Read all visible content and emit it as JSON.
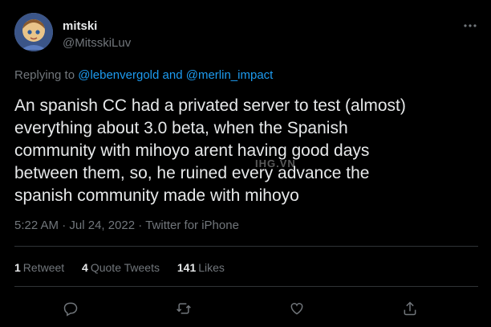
{
  "user": {
    "name": "mitski",
    "handle": "@MitsskiLuv"
  },
  "reply": {
    "prefix": "Replying to",
    "mention1": "@lebenvergold",
    "conj": "and",
    "mention2": "@merlin_impact"
  },
  "tweet": {
    "line1": "An spanish CC had a privated server to test (almost)",
    "line2": "everything about 3.0 beta, when the Spanish",
    "line3": "community with mihoyo arent having good days",
    "line4": "between them, so, he ruined every advance the",
    "line5": "spanish community made with mihoyo"
  },
  "meta": {
    "time": "5:22 AM",
    "dot": "·",
    "date": "Jul 24, 2022",
    "source": "Twitter for iPhone"
  },
  "stats": {
    "retweets_count": "1",
    "retweets_label": "Retweet",
    "quotes_count": "4",
    "quotes_label": "Quote Tweets",
    "likes_count": "141",
    "likes_label": "Likes"
  },
  "watermark": "IHG.VN",
  "icons": [
    "more-icon",
    "reply-icon",
    "retweet-icon",
    "like-icon",
    "share-icon"
  ],
  "colors": {
    "background": "#000000",
    "text": "#e7e9ea",
    "muted": "#71767b",
    "accent": "#1d9bf0",
    "divider": "#2f3336"
  }
}
